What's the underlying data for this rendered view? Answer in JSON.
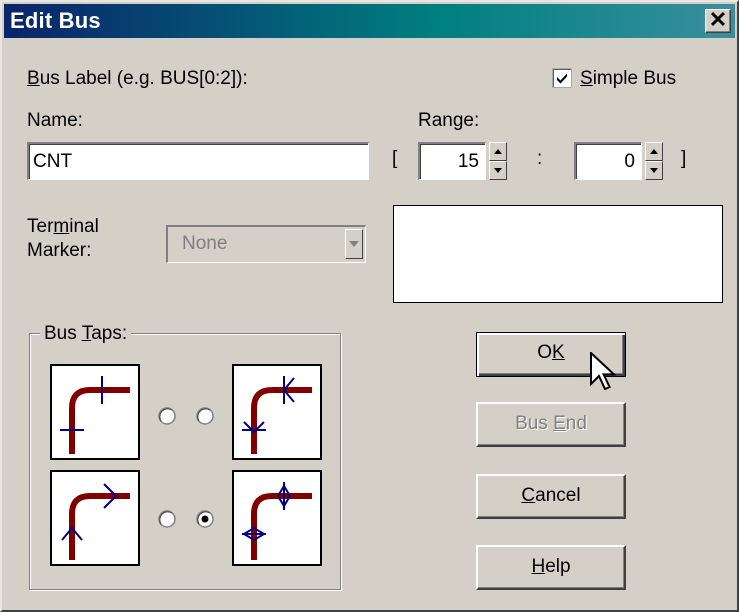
{
  "window": {
    "title": "Edit Bus",
    "close_label": "✕"
  },
  "bus_label": {
    "prefix_u": "B",
    "rest": "us Label (e.g. BUS[0:2]):"
  },
  "simple_bus": {
    "checked": true,
    "label_u": "S",
    "label_rest": "imple Bus"
  },
  "name": {
    "label": "Name:",
    "value": "CNT"
  },
  "range": {
    "label": "Range:",
    "open_bracket": "[",
    "start": "15",
    "separator": ":",
    "end": "0",
    "close_bracket": "]"
  },
  "terminal": {
    "label_line1_pre": "Ter",
    "label_line1_u": "m",
    "label_line1_post": "inal",
    "label_line2": "Marker:",
    "selected": "None"
  },
  "bus_taps": {
    "label_pre": "Bus ",
    "label_u": "T",
    "label_post": "aps:",
    "selected_index": 3
  },
  "buttons": {
    "ok": {
      "u": "K",
      "pre": "O",
      "post": ""
    },
    "bus_end": {
      "pre": "Bus ",
      "u": "E",
      "post": "nd"
    },
    "cancel": {
      "pre": "",
      "u": "C",
      "post": "ancel"
    },
    "help": {
      "pre": "",
      "u": "H",
      "post": "elp"
    }
  },
  "colors": {
    "title_start": "#0a246a",
    "title_end": "#008080",
    "wire": "#800000",
    "marker": "#000080"
  }
}
